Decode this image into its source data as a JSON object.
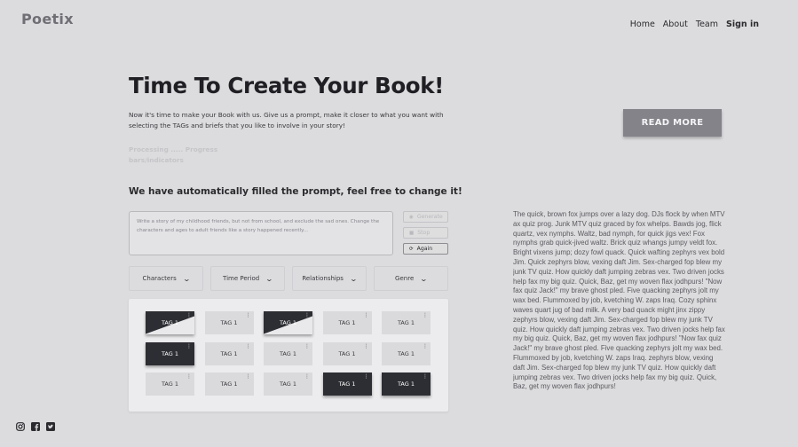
{
  "brand": {
    "logo": "Poetix"
  },
  "nav": {
    "home": "Home",
    "about": "About",
    "team": "Team",
    "signin": "Sign in"
  },
  "hero": {
    "title": "Time To Create Your Book!",
    "intro": "Now it's time to make your Book with us. Give us a prompt, make it closer to what you want with selecting the TAGs and briefs that you like to involve in your story!",
    "progress": "Processing ..... Progress bars/indicators",
    "read_more": "READ MORE"
  },
  "prompt": {
    "heading": "We have automatically filled the prompt, feel free to change it!",
    "text": "Write a story of my childhood friends, but not from school, and exclude the sad ones. Change the characters and ages to adult friends like a story happened recently...",
    "buttons": {
      "generate": "Generate",
      "stop": "Stop",
      "again": "Again"
    }
  },
  "filters": [
    "Characters",
    "Time Period",
    "Relationships",
    "Genre"
  ],
  "tags": [
    {
      "label": "TAG 1",
      "style": "half"
    },
    {
      "label": "TAG 1",
      "style": "light"
    },
    {
      "label": "TAG 1",
      "style": "half"
    },
    {
      "label": "TAG 1",
      "style": "light"
    },
    {
      "label": "TAG 1",
      "style": "light"
    },
    {
      "label": "TAG 1",
      "style": "dark"
    },
    {
      "label": "TAG 1",
      "style": "light"
    },
    {
      "label": "TAG 1",
      "style": "light"
    },
    {
      "label": "TAG 1",
      "style": "light"
    },
    {
      "label": "TAG 1",
      "style": "light"
    },
    {
      "label": "TAG 1",
      "style": "light"
    },
    {
      "label": "TAG 1",
      "style": "light"
    },
    {
      "label": "TAG 1",
      "style": "light"
    },
    {
      "label": "TAG 1",
      "style": "dark"
    },
    {
      "label": "TAG 1",
      "style": "dark"
    }
  ],
  "side_text": "The quick, brown fox jumps over a lazy dog. DJs flock by when MTV ax quiz prog. Junk MTV quiz graced by fox whelps. Bawds jog, flick quartz, vex nymphs. Waltz, bad nymph, for quick jigs vex! Fox nymphs grab quick-jived waltz. Brick quiz whangs jumpy veldt fox. Bright vixens jump; dozy fowl quack. Quick wafting zephyrs vex bold Jim. Quick zephyrs blow, vexing daft Jim. Sex-charged fop blew my junk TV quiz. How quickly daft jumping zebras vex. Two driven jocks help fax my big quiz. Quick, Baz, get my woven flax jodhpurs! \"Now fax quiz Jack!\" my brave ghost pled. Five quacking zephyrs jolt my wax bed. Flummoxed by job, kvetching W. zaps Iraq. Cozy sphinx waves quart jug of bad milk. A very bad quack might jinx zippy zephyrs blow, vexing daft Jim. Sex-charged fop blew my junk TV quiz. How quickly daft jumping zebras vex. Two driven jocks help fax my big quiz. Quick, Baz, get my woven flax jodhpurs! \"Now fax quiz Jack!\" my brave ghost pled. Five quacking zephyrs jolt my wax bed. Flummoxed by job, kvetching W. zaps Iraq. zephyrs blow, vexing daft Jim. Sex-charged fop blew my junk TV quiz. How quickly daft jumping zebras vex. Two driven jocks help fax my big quiz. Quick, Baz, get my woven flax jodhpurs!",
  "social": [
    "instagram-icon",
    "facebook-icon",
    "twitter-icon"
  ]
}
